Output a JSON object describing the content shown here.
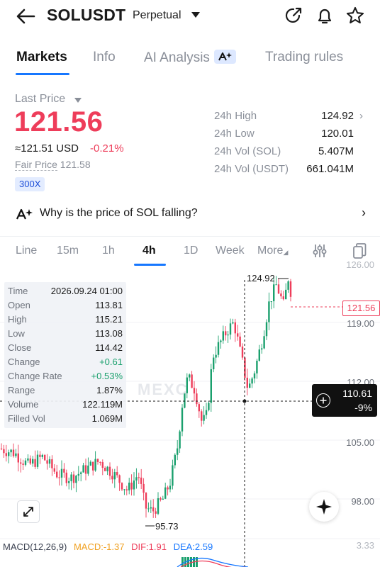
{
  "header": {
    "title": "SOLUSDT",
    "subtitle": "Perpetual",
    "icons": [
      "back-arrow-icon",
      "share-icon",
      "bell-icon",
      "star-icon"
    ]
  },
  "tabs": [
    {
      "label": "Markets",
      "active": true
    },
    {
      "label": "Info",
      "active": false
    },
    {
      "label": "AI Analysis",
      "active": false
    },
    {
      "label": "Trading rules",
      "active": false
    }
  ],
  "price": {
    "last_price_label": "Last Price",
    "last_price": "121.56",
    "approx": "≈121.51",
    "currency": "USD",
    "change": "-0.21%",
    "fair_price_label": "Fair Price",
    "fair_price": "121.58",
    "leverage": "300X"
  },
  "stats": [
    {
      "label": "24h High",
      "value": "124.92"
    },
    {
      "label": "24h Low",
      "value": "120.01"
    },
    {
      "label": "24h Vol (SOL)",
      "value": "5.407M"
    },
    {
      "label": "24h Vol (USDT)",
      "value": "661.041M"
    }
  ],
  "ai_question": "Why is the price of SOL falling?",
  "intervals": [
    {
      "label": "Line",
      "active": false
    },
    {
      "label": "15m",
      "active": false
    },
    {
      "label": "1h",
      "active": false
    },
    {
      "label": "4h",
      "active": true
    },
    {
      "label": "1D",
      "active": false
    },
    {
      "label": "Week",
      "active": false
    },
    {
      "label": "More",
      "active": false
    }
  ],
  "candle_info": [
    {
      "k": "Time",
      "v": "2026.09.24 01:00"
    },
    {
      "k": "Open",
      "v": "113.81"
    },
    {
      "k": "High",
      "v": "115.21"
    },
    {
      "k": "Low",
      "v": "113.08"
    },
    {
      "k": "Close",
      "v": "114.42"
    },
    {
      "k": "Change",
      "v": "+0.61"
    },
    {
      "k": "Change Rate",
      "v": "+0.53%"
    },
    {
      "k": "Range",
      "v": "1.87%"
    },
    {
      "k": "Volume",
      "v": "122.119M"
    },
    {
      "k": "Filled Vol",
      "v": "1.069M"
    }
  ],
  "chart": {
    "y_labels": [
      "126.00",
      "119.00",
      "112.00",
      "105.00",
      "98.00",
      "3.33"
    ],
    "high_marker": "124.92",
    "low_marker": "95.73",
    "current_price_tag": "121.56",
    "crosshair_price": "110.61",
    "crosshair_pct": "-9%",
    "watermark": "MEXC",
    "colors": {
      "up": "#1aa06d",
      "down": "#ee3d5a",
      "accent": "#1677ff"
    }
  },
  "chart_data": {
    "type": "candlestick",
    "ylim": [
      95,
      126
    ],
    "ticks": [
      126,
      119,
      112,
      105,
      98
    ],
    "high": 124.92,
    "low": 95.73,
    "last": 121.56,
    "crosshair": 110.61
  },
  "macd": {
    "label": "MACD(12,26,9)",
    "macd": "MACD:-1.37",
    "dif": "DIF:1.91",
    "dea": "DEA:2.59"
  }
}
